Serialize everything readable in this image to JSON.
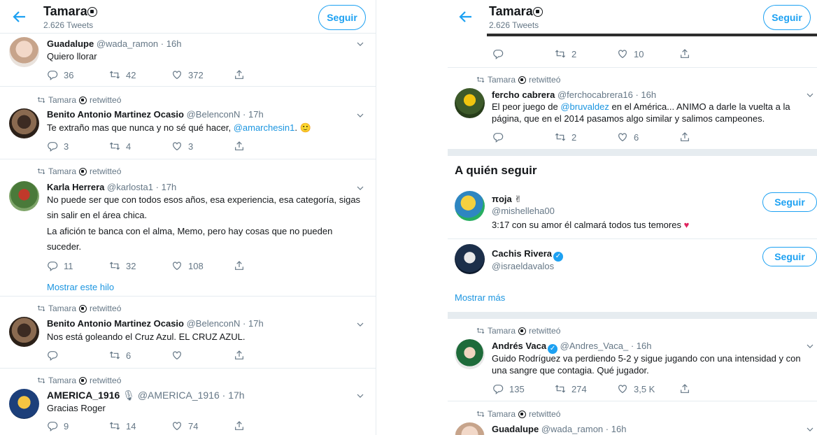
{
  "header": {
    "title": "Tamara",
    "tweets_count": "2.626 Tweets",
    "follow_label": "Seguir"
  },
  "retweet_label": "Tamara",
  "retweet_suffix": "retwitteó",
  "left_tweets": [
    {
      "name": "Guadalupe",
      "handle": "@wada_ramon",
      "time": "16h",
      "text": "Quiero llorar",
      "replies": "36",
      "retweets": "42",
      "likes": "372"
    },
    {
      "name": "Benito Antonio Martinez Ocasio",
      "handle": "@BelenconN",
      "time": "17h",
      "text": "Te extraño mas que nunca y no sé qué hacer,",
      "mention": "@amarchesin1",
      "text_end": ".",
      "replies": "3",
      "retweets": "4",
      "likes": "3"
    },
    {
      "name": "Karla Herrera",
      "handle": "@karlosta1",
      "time": "17h",
      "text": "No puede ser que con todos esos años, esa experiencia, esa categoría, sigas sin salir en el área chica.",
      "text2": "La afición te banca con el alma, Memo, pero hay cosas que no pueden suceder.",
      "replies": "11",
      "retweets": "32",
      "likes": "108",
      "thread_label": "Mostrar este hilo"
    },
    {
      "name": "Benito Antonio Martinez Ocasio",
      "handle": "@BelenconN",
      "time": "17h",
      "text": "Nos está goleando el Cruz Azul. EL CRUZ AZUL.",
      "replies": "",
      "retweets": "6",
      "likes": ""
    },
    {
      "name": "AMERICA_1916",
      "handle": "@AMERICA_1916",
      "time": "17h",
      "text": "Gracias Roger",
      "replies": "9",
      "retweets": "14",
      "likes": "74"
    }
  ],
  "right_top_actions": {
    "replies": "",
    "retweets": "2",
    "likes": "10"
  },
  "right_tweet1": {
    "name": "fercho cabrera",
    "handle": "@ferchocabrera16",
    "time": "16h",
    "text_a": "El peor juego de",
    "mention": "@bruvaldez",
    "text_b": "en el América... ANIMO a darle la vuelta a la página, que en el 2014 pasamos algo similar y salimos campeones.",
    "replies": "",
    "retweets": "2",
    "likes": "6"
  },
  "who_to_follow": {
    "title": "A quién seguir",
    "users": [
      {
        "name": "πoja",
        "handle": "@mishelleha00",
        "bio": "3:17 con su amor él calmará todos tus temores",
        "follow": "Seguir"
      },
      {
        "name": "Cachis Rivera",
        "handle": "@israeldavalos",
        "follow": "Seguir"
      }
    ],
    "more": "Mostrar más"
  },
  "right_tweet2": {
    "name": "Andrés Vaca",
    "handle": "@Andres_Vaca_",
    "time": "16h",
    "text": "Guido Rodríguez va perdiendo 5-2 y sigue jugando con una intensidad y con una sangre que contagia. Qué jugador.",
    "replies": "135",
    "retweets": "274",
    "likes": "3,5 K"
  },
  "right_tweet3": {
    "name": "Guadalupe",
    "handle": "@wada_ramon",
    "time": "16h"
  },
  "colors": {
    "accent": "#1da1f2",
    "link": "#1b95e0",
    "muted": "#657786",
    "heart": "#e0245e"
  }
}
